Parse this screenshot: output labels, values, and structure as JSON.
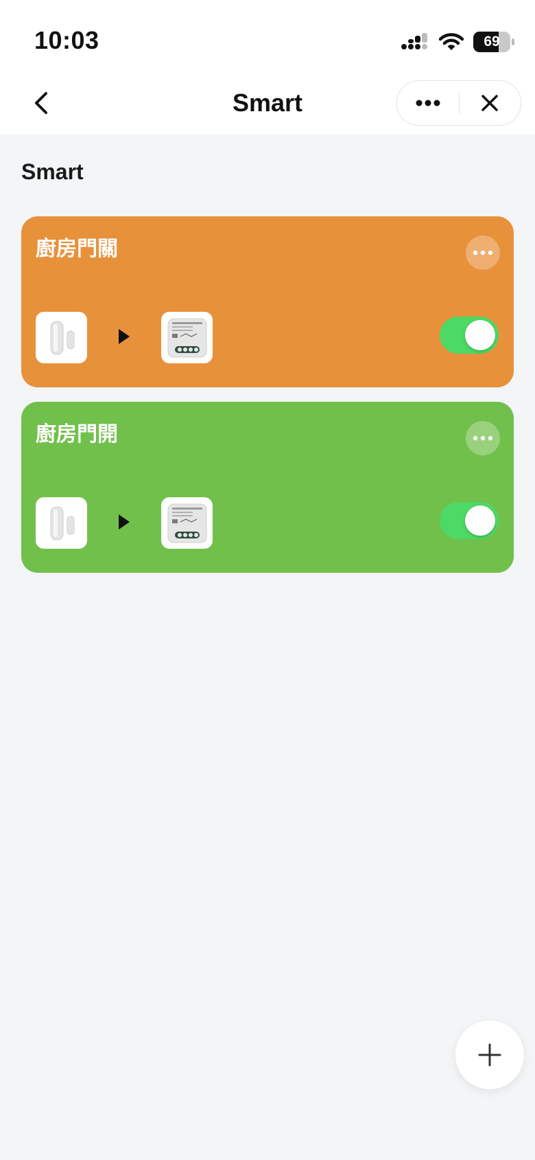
{
  "status_bar": {
    "time": "10:03",
    "battery_level": "69",
    "battery_fraction": 0.69
  },
  "nav": {
    "title": "Smart",
    "back_icon": "chevron-left-icon",
    "more_icon": "ellipsis-icon",
    "close_icon": "close-icon"
  },
  "section": {
    "title": "Smart"
  },
  "scenes": [
    {
      "name": "廚房門關",
      "color": "#e8913b",
      "enabled": true,
      "condition_device_icon": "door-sensor-icon",
      "action_device_icon": "switch-module-icon"
    },
    {
      "name": "廚房門開",
      "color": "#72c04c",
      "enabled": true,
      "condition_device_icon": "door-sensor-icon",
      "action_device_icon": "switch-module-icon"
    }
  ],
  "fab": {
    "icon": "plus-icon"
  },
  "colors": {
    "toggle_on": "#4cd964",
    "page_bg": "#f4f5f7"
  }
}
